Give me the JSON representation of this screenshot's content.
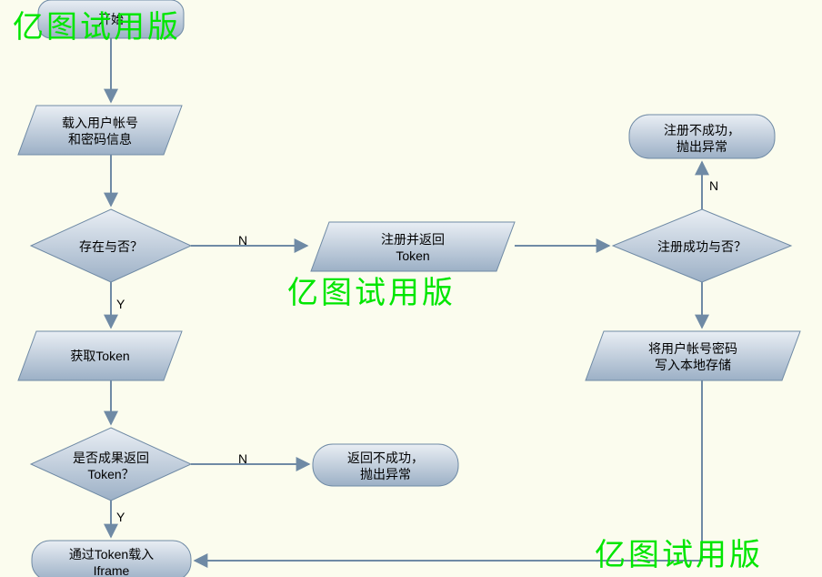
{
  "watermarks": {
    "top_left": "亿图试用版",
    "center": "亿图试用版",
    "bottom_right": "亿图试用版"
  },
  "nodes": {
    "start": "开始",
    "load_user_line1": "载入用户帐号",
    "load_user_line2": "和密码信息",
    "exists": "存在与否？",
    "get_token": "获取Token",
    "token_ok_line1": "是否成果返回",
    "token_ok_line2": "Token？",
    "iframe_line1": "通过Token载入",
    "iframe_line2": "Iframe",
    "register_line1": "注册并返回",
    "register_line2": "Token",
    "reg_success": "注册成功与否？",
    "reg_fail_line1": "注册不成功，",
    "reg_fail_line2": "抛出异常",
    "save_line1": "将用户帐号密码",
    "save_line2": "写入本地存储",
    "return_fail_line1": "返回不成功，",
    "return_fail_line2": "抛出异常"
  },
  "edges": {
    "n1": "N",
    "y1": "Y",
    "n2": "N",
    "y2": "Y",
    "n3": "N"
  }
}
